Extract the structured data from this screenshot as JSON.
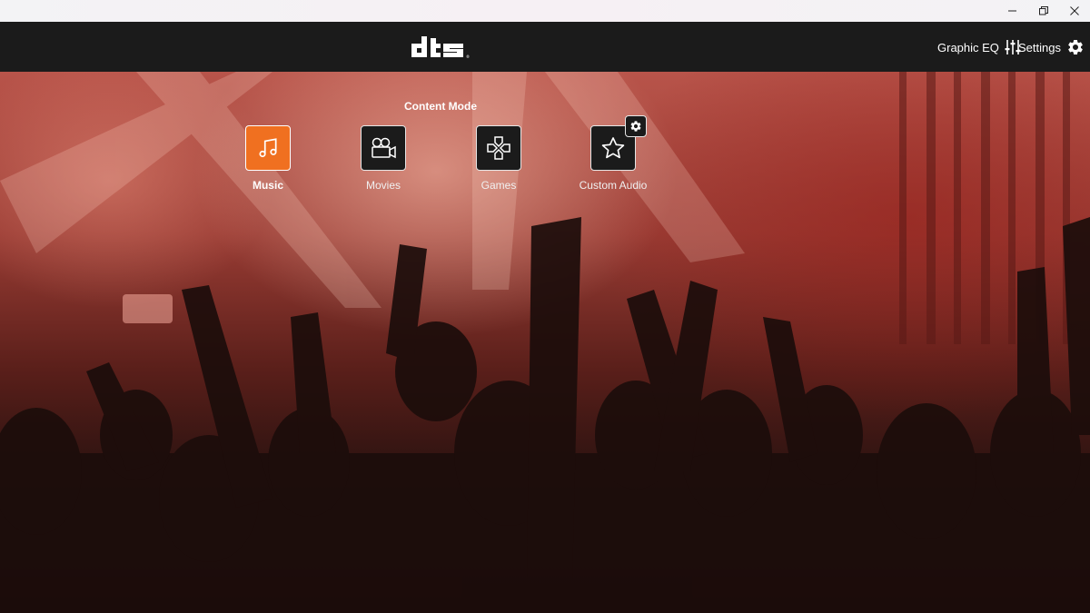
{
  "window": {
    "controls": [
      {
        "name": "minimize-icon"
      },
      {
        "name": "restore-icon"
      },
      {
        "name": "close-icon"
      }
    ]
  },
  "header": {
    "logo_text": "dts",
    "graphic_eq_label": "Graphic EQ",
    "settings_label": "Settings"
  },
  "content_mode": {
    "title": "Content Mode",
    "modes": [
      {
        "label": "Music",
        "icon": "music-note-icon",
        "selected": true
      },
      {
        "label": "Movies",
        "icon": "video-camera-icon",
        "selected": false
      },
      {
        "label": "Games",
        "icon": "game-controller-icon",
        "selected": false
      },
      {
        "label": "Custom Audio",
        "icon": "star-icon",
        "selected": false,
        "badge_icon": "gear-icon"
      }
    ]
  },
  "colors": {
    "accent": "#f07020",
    "header_bg": "#1b1b1b"
  }
}
